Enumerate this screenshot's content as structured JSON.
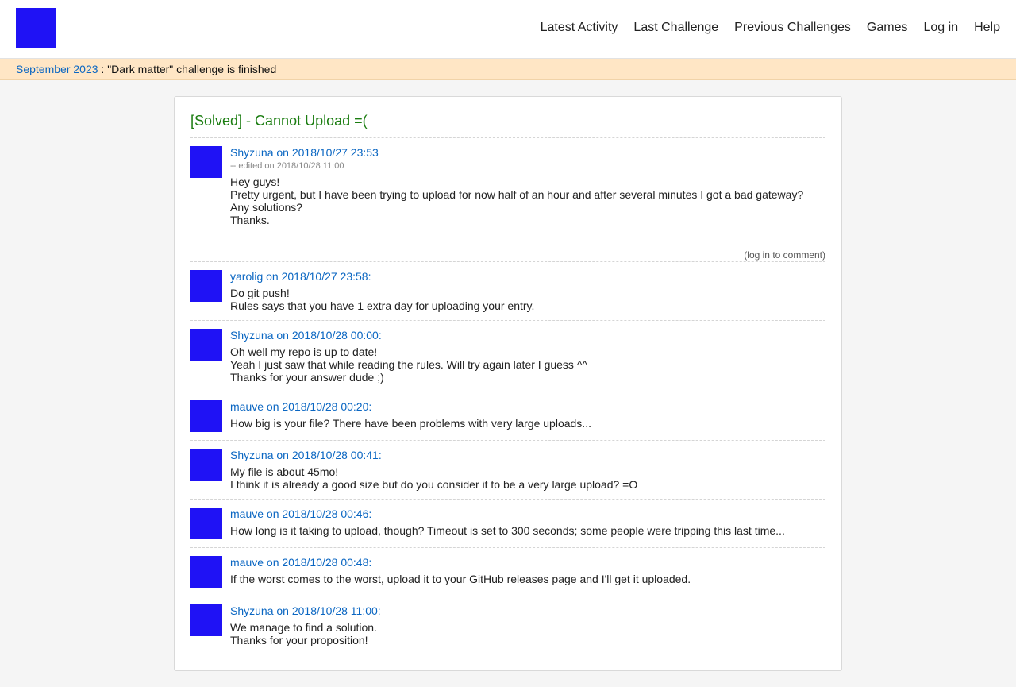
{
  "nav": {
    "items": [
      "Latest Activity",
      "Last Challenge",
      "Previous Challenges",
      "Games",
      "Log in",
      "Help"
    ]
  },
  "banner": {
    "link": "September 2023",
    "text": " : \"Dark matter\" challenge is finished"
  },
  "thread": {
    "title": "[Solved] - Cannot Upload =(",
    "op": {
      "header": "Shyzuna on 2018/10/27 23:53",
      "edited": "-- edited on 2018/10/28 11:00",
      "lines": [
        "Hey guys!",
        "Pretty urgent, but I have been trying to upload for now half of an hour and after several minutes I got a bad gateway?",
        "Any solutions?",
        "Thanks."
      ],
      "comment_link": "(log in to comment)"
    },
    "replies": [
      {
        "header": "yarolig on 2018/10/27 23:58:",
        "lines": [
          "Do git push!",
          "Rules says that you have 1 extra day for uploading your entry."
        ]
      },
      {
        "header": "Shyzuna on 2018/10/28 00:00:",
        "lines": [
          "Oh well my repo is up to date!",
          "Yeah I just saw that while reading the rules. Will try again later I guess ^^",
          "Thanks for your answer dude ;)"
        ]
      },
      {
        "header": "mauve on 2018/10/28 00:20:",
        "lines": [
          "How big is your file? There have been problems with very large uploads..."
        ]
      },
      {
        "header": "Shyzuna on 2018/10/28 00:41:",
        "lines": [
          "My file is about 45mo!",
          "I think it is already a good size but do you consider it to be a very large upload? =O"
        ]
      },
      {
        "header": "mauve on 2018/10/28 00:46:",
        "lines": [
          "How long is it taking to upload, though? Timeout is set to 300 seconds; some people were tripping this last time..."
        ]
      },
      {
        "header": "mauve on 2018/10/28 00:48:",
        "lines": [
          "If the worst comes to the worst, upload it to your GitHub releases page and I'll get it uploaded."
        ]
      },
      {
        "header": "Shyzuna on 2018/10/28 11:00:",
        "lines": [
          "We manage to find a solution.",
          "Thanks for your proposition!"
        ]
      }
    ]
  },
  "colors": {
    "avatar": "#1f12f5",
    "link": "#0a66c2",
    "title": "#1b7d11",
    "banner_bg": "#ffe6c5"
  }
}
